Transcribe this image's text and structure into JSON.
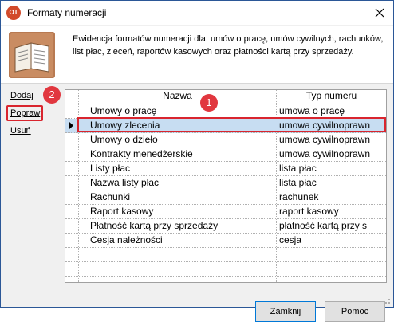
{
  "window": {
    "title": "Formaty numeracji",
    "app_icon": "OT"
  },
  "header": {
    "description": "Ewidencja formatów numeracji dla: umów o pracę, umów cywilnych, rachunków, list płac, zleceń, raportów kasowych oraz płatności kartą przy sprzedaży."
  },
  "actions": {
    "add": "Dodaj",
    "edit": "Popraw",
    "delete": "Usuń"
  },
  "grid": {
    "columns": [
      "Nazwa",
      "Typ numeru"
    ],
    "selected_index": 1,
    "rows": [
      {
        "name": "Umowy o pracę",
        "type": "umowa o pracę"
      },
      {
        "name": "Umowy zlecenia",
        "type": "umowa cywilnoprawn"
      },
      {
        "name": "Umowy o dzieło",
        "type": "umowa cywilnoprawn"
      },
      {
        "name": "Kontrakty menedżerskie",
        "type": "umowa cywilnoprawn"
      },
      {
        "name": "Listy płac",
        "type": "lista płac"
      },
      {
        "name": "Nazwa listy płac",
        "type": "lista płac"
      },
      {
        "name": "Rachunki",
        "type": "rachunek"
      },
      {
        "name": "Raport kasowy",
        "type": "raport kasowy"
      },
      {
        "name": "Płatność kartą przy sprzedaży",
        "type": "płatność kartą przy s"
      },
      {
        "name": "Cesja należności",
        "type": "cesja"
      }
    ]
  },
  "callouts": {
    "one": "1",
    "two": "2"
  },
  "buttons": {
    "close": "Zamknij",
    "help": "Pomoc"
  },
  "colors": {
    "highlight": "#d9252e",
    "selection": "#c7ddf2",
    "badge": "#e1373f"
  }
}
